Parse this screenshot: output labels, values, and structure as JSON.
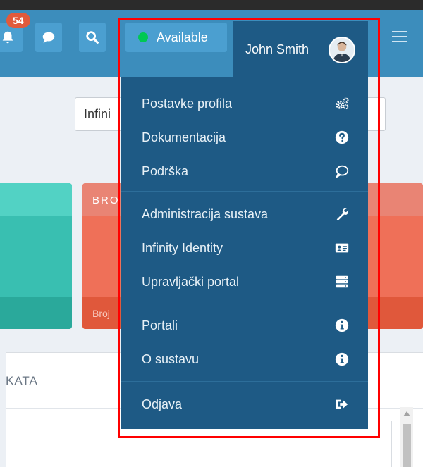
{
  "navbar": {
    "notifications_count": "54",
    "status_label": "Available",
    "user_name": "John Smith"
  },
  "search": {
    "value": "Infini"
  },
  "cards": {
    "red_title": "BRO",
    "red_footer": "Broj"
  },
  "panel": {
    "title": "KATA"
  },
  "menu": {
    "items": [
      {
        "label": "Postavke profila",
        "icon": "cogs-icon"
      },
      {
        "label": "Dokumentacija",
        "icon": "question-circle-icon"
      },
      {
        "label": "Podrška",
        "icon": "chat-bubble-icon"
      },
      {
        "label": "Administracija sustava",
        "icon": "wrench-icon"
      },
      {
        "label": "Infinity Identity",
        "icon": "id-card-icon"
      },
      {
        "label": "Upravljački portal",
        "icon": "server-icon"
      },
      {
        "label": "Portali",
        "icon": "info-circle-icon"
      },
      {
        "label": "O sustavu",
        "icon": "info-circle-icon"
      },
      {
        "label": "Odjava",
        "icon": "sign-out-icon"
      }
    ]
  },
  "colors": {
    "navbar": "#3c8dbc",
    "dropdown": "#1e5a85",
    "status_online": "#00c853",
    "badge": "#e15a3c",
    "highlight": "#ff0000"
  }
}
